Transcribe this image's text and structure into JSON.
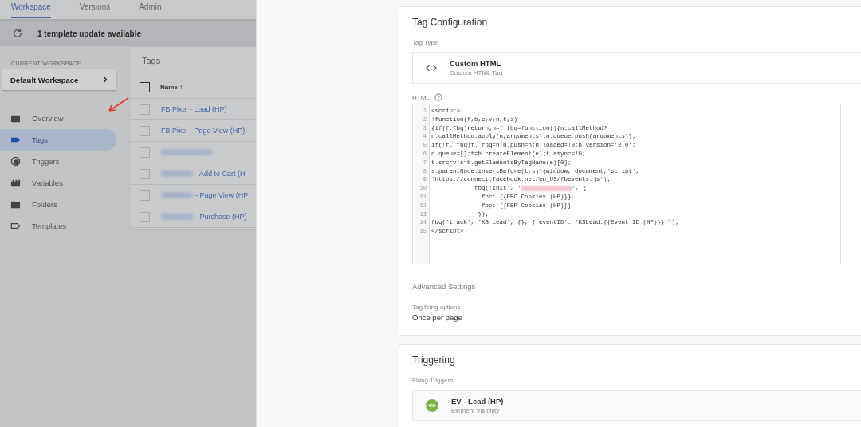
{
  "tabs": [
    {
      "label": "Workspace",
      "selected": true
    },
    {
      "label": "Versions",
      "selected": false
    },
    {
      "label": "Admin",
      "selected": false
    }
  ],
  "banner": {
    "text": "1 template update available"
  },
  "workspace": {
    "label": "CURRENT WORKSPACE",
    "name": "Default Workspace"
  },
  "nav": [
    {
      "label": "Overview",
      "kind": "overview",
      "selected": false
    },
    {
      "label": "Tags",
      "kind": "tags",
      "selected": true
    },
    {
      "label": "Triggers",
      "kind": "triggers",
      "selected": false
    },
    {
      "label": "Variables",
      "kind": "variables",
      "selected": false
    },
    {
      "label": "Folders",
      "kind": "folders",
      "selected": false
    },
    {
      "label": "Templates",
      "kind": "templates",
      "selected": false
    }
  ],
  "tags_card": {
    "title": "Tags",
    "column": "Name",
    "sort_indicator": "↑",
    "all_checked": false,
    "rows": [
      {
        "name": "FB Pixel - Lead (HP)",
        "redacted": false,
        "checked": false
      },
      {
        "name": "FB Pixel - Page View (HP)",
        "redacted": false,
        "checked": false
      },
      {
        "redacted": true,
        "checked": false
      },
      {
        "name": "- Add to Cart (H",
        "redacted": true,
        "checked": false
      },
      {
        "name": "- Page View (HP",
        "redacted": true,
        "checked": false
      },
      {
        "name": "- Purchase (HP)",
        "redacted": true,
        "checked": false
      }
    ]
  },
  "config": {
    "title": "Tag Configuration",
    "type_label": "Tag Type",
    "type_name": "Custom HTML",
    "type_desc": "Custom HTML Tag",
    "html_label": "HTML",
    "code": [
      {
        "n": "1",
        "text": "<script>"
      },
      {
        "n": "2",
        "text": "!function(f,b,e,v,n,t,s)"
      },
      {
        "n": "3",
        "text": "{if(f.fbq)return;n=f.fbq=function(){n.callMethod?"
      },
      {
        "n": "4",
        "text": "n.callMethod.apply(n,arguments):n.queue.push(arguments)};"
      },
      {
        "n": "5",
        "text": "if(!f._fbq)f._fbq=n;n.push=n;n.loaded=!0;n.version='2.0';"
      },
      {
        "n": "6",
        "text": "n.queue=[];t=b.createElement(e);t.async=!0;"
      },
      {
        "n": "7",
        "text": "t.src=v;s=b.getElementsByTagName(e)[0];"
      },
      {
        "n": "8",
        "text": "s.parentNode.insertBefore(t,s)}(window, document,'script',"
      },
      {
        "n": "9",
        "text": "'https://connect.facebook.net/en_US/fbevents.js');"
      },
      {
        "n": "10",
        "text": "            fbq('init', '",
        "redacted": true,
        "rest": "', {"
      },
      {
        "n": "11",
        "text": "              fbc: {{FBC Cookies (HP)}},"
      },
      {
        "n": "12",
        "text": "              fbp: {{FBP Cookies (HP)}}"
      },
      {
        "n": "13",
        "text": "             });"
      },
      {
        "n": "14",
        "text": "fbq('track', 'KS Lead', {}, {'eventID': 'KSLead.{{Event ID (HP)}}'});"
      },
      {
        "n": "15",
        "text": "</script>"
      }
    ],
    "advanced": "Advanced Settings",
    "firing_label": "Tag firing options",
    "firing_value": "Once per page"
  },
  "triggering": {
    "title": "Triggering",
    "label": "Firing Triggers",
    "trigger_name": "EV - Lead (HP)",
    "trigger_type": "Element Visibility"
  }
}
